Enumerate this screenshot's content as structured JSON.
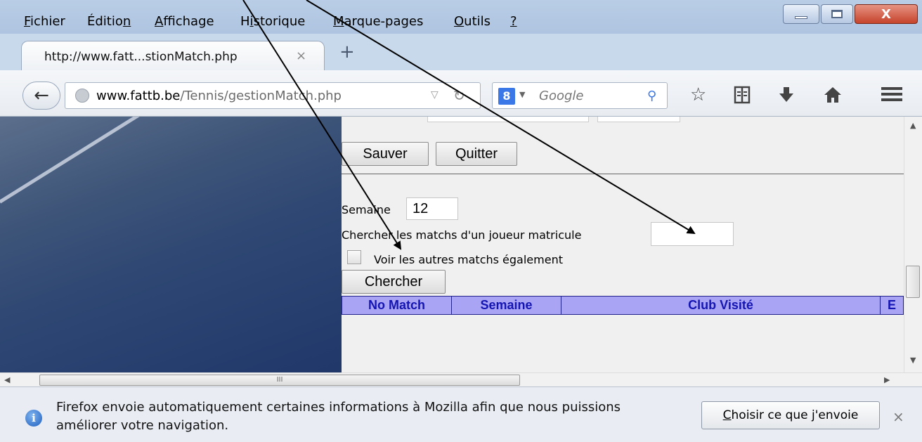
{
  "menubar": {
    "items": [
      {
        "label": "Fichier",
        "accel": "F"
      },
      {
        "label": "Édition",
        "accel": "n"
      },
      {
        "label": "Affichage",
        "accel": "A"
      },
      {
        "label": "Historique",
        "accel": "i"
      },
      {
        "label": "Marque-pages",
        "accel": "M"
      },
      {
        "label": "Outils",
        "accel": "O"
      },
      {
        "label": "?",
        "accel": "?"
      }
    ]
  },
  "window_controls": {
    "minimize": "—",
    "maximize": "☐",
    "close": "X"
  },
  "tabs": [
    {
      "title": "http://www.fatt...stionMatch.php",
      "close": "×"
    }
  ],
  "new_tab": "+",
  "navbar": {
    "back": "←",
    "url_domain": "www.fattb.be",
    "url_path": "/Tennis/gestionMatch.php",
    "search_engine": "8",
    "search_placeholder": "Google"
  },
  "toolbar_icons": [
    "star-icon",
    "reading-list-icon",
    "download-icon",
    "home-icon",
    "menu-icon"
  ],
  "form": {
    "save_button": "Sauver",
    "quit_button": "Quitter",
    "week_label": "Semaine",
    "week_value": "12",
    "player_label": "Chercher les matchs d'un joueur matricule",
    "player_value": "",
    "others_label": "Voir les autres matchs également",
    "others_checked": false,
    "search_button": "Chercher"
  },
  "table": {
    "headers": [
      "No Match",
      "Semaine",
      "Club Visité",
      "E"
    ]
  },
  "hscroll_grip": "III",
  "notification": {
    "text": "Firefox envoie automatiquement certaines informations à Mozilla afin que nous puissions améliorer votre navigation.",
    "button": "Choisir ce que j'envoie",
    "close": "×"
  }
}
